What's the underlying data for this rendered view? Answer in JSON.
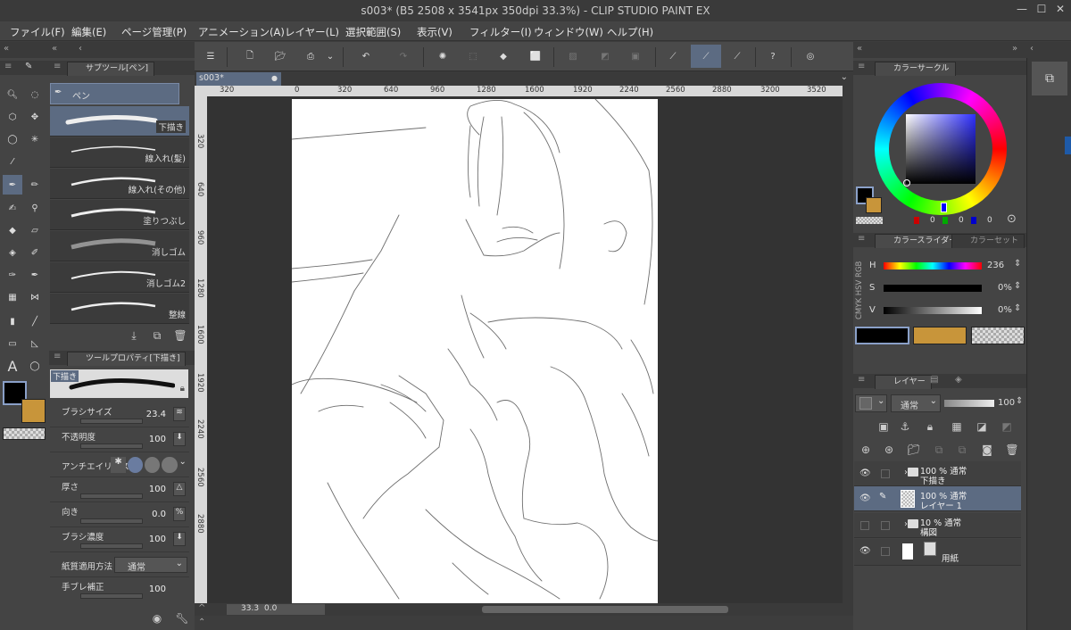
{
  "window": {
    "title": "s003* (B5 2508 x 3541px 350dpi 33.3%)  - CLIP STUDIO PAINT EX"
  },
  "menu": [
    "ファイル(F)",
    "編集(E)",
    "ページ管理(P)",
    "アニメーション(A)",
    "レイヤー(L)",
    "選択範囲(S)",
    "表示(V)",
    "フィルター(I)",
    "ウィンドウ(W)",
    "ヘルプ(H)"
  ],
  "subtool": {
    "tab_label": "サブツール[ペン]",
    "group_label": "ペン",
    "brushes": [
      "下描き",
      "線入れ(髪)",
      "線入れ(その他)",
      "塗りつぶし",
      "消しゴム",
      "消しゴム2",
      "整線"
    ]
  },
  "toolprop": {
    "tab_label": "ツールプロパティ[下描き]",
    "preview_label": "下描き",
    "props": [
      {
        "label": "ブラシサイズ",
        "value": "23.4"
      },
      {
        "label": "不透明度",
        "value": "100"
      },
      {
        "label": "アンチエイリアス",
        "value": ""
      },
      {
        "label": "厚さ",
        "value": "100"
      },
      {
        "label": "向き",
        "value": "0.0"
      },
      {
        "label": "ブラシ濃度",
        "value": "100"
      },
      {
        "label": "紙質適用方法",
        "value": "通常"
      },
      {
        "label": "手ブレ補正",
        "value": "100"
      }
    ]
  },
  "canvas": {
    "tab_label": "s003*",
    "ruler_ticks": [
      "320",
      "0",
      "320",
      "640",
      "960",
      "1280",
      "1600",
      "1920",
      "2240",
      "2560",
      "2880",
      "3200",
      "3520"
    ],
    "vruler_ticks": [
      "320",
      "640",
      "960",
      "1280",
      "1600",
      "1920",
      "2240",
      "2560",
      "2880"
    ],
    "zoom": "33.3",
    "angle": "0.0"
  },
  "color": {
    "circle_tab": "カラーサークル",
    "slider_tab": "カラースライダー",
    "set_tab": "カラーセット",
    "rgb_values": [
      "0",
      "0",
      "0"
    ],
    "h_label": "H",
    "h_value": "236",
    "s_label": "S",
    "s_value": "0%",
    "v_label": "V",
    "v_value": "0%",
    "mode_tabs": "CMYK HSV RGB",
    "main_color": "#000000",
    "sub_color": "#c8953a"
  },
  "layers": {
    "tab_label": "レイヤー",
    "blend_mode": "通常",
    "opacity": "100",
    "rows": [
      {
        "l1": "100 % 通常",
        "l2": "下描き",
        "type": "folder"
      },
      {
        "l1": "100 % 通常",
        "l2": "レイヤー 1",
        "type": "layer"
      },
      {
        "l1": "10 % 通常",
        "l2": "構図",
        "type": "folder"
      },
      {
        "l1": "",
        "l2": "用紙",
        "type": "paper"
      }
    ]
  }
}
